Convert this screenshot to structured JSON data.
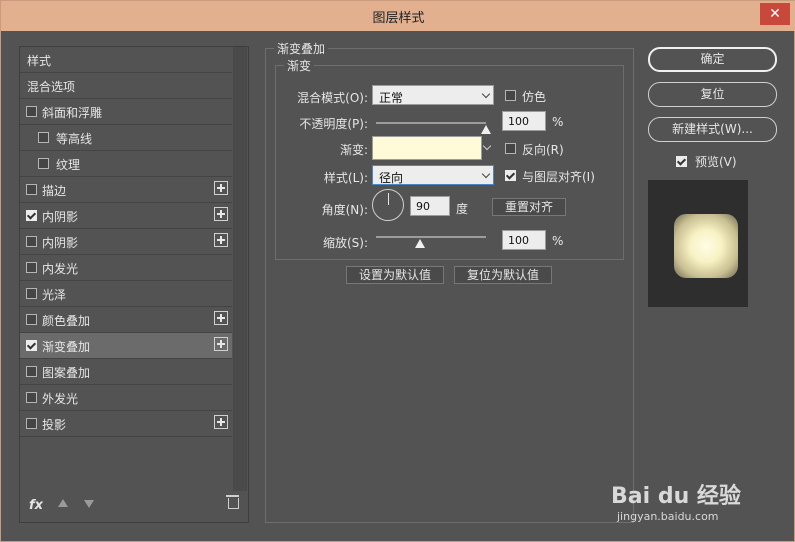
{
  "window": {
    "title": "图层样式",
    "close_glyph": "✕"
  },
  "sidebar": {
    "items": [
      {
        "label": "样式",
        "checkbox": null,
        "plus": false,
        "selected": false
      },
      {
        "label": "混合选项",
        "checkbox": null,
        "plus": false,
        "selected": false
      },
      {
        "label": "斜面和浮雕",
        "checkbox": false,
        "plus": false,
        "selected": false
      },
      {
        "label": "等高线",
        "checkbox": false,
        "plus": false,
        "selected": false,
        "sub": true
      },
      {
        "label": "纹理",
        "checkbox": false,
        "plus": false,
        "selected": false,
        "sub": true
      },
      {
        "label": "描边",
        "checkbox": false,
        "plus": true,
        "selected": false
      },
      {
        "label": "内阴影",
        "checkbox": true,
        "plus": true,
        "selected": false
      },
      {
        "label": "内阴影",
        "checkbox": false,
        "plus": true,
        "selected": false
      },
      {
        "label": "内发光",
        "checkbox": false,
        "plus": false,
        "selected": false
      },
      {
        "label": "光泽",
        "checkbox": false,
        "plus": false,
        "selected": false
      },
      {
        "label": "颜色叠加",
        "checkbox": false,
        "plus": true,
        "selected": false
      },
      {
        "label": "渐变叠加",
        "checkbox": true,
        "plus": true,
        "selected": true
      },
      {
        "label": "图案叠加",
        "checkbox": false,
        "plus": false,
        "selected": false
      },
      {
        "label": "外发光",
        "checkbox": false,
        "plus": false,
        "selected": false
      },
      {
        "label": "投影",
        "checkbox": false,
        "plus": true,
        "selected": false
      }
    ],
    "fx_label": "fx"
  },
  "panel": {
    "group_title": "渐变叠加",
    "subgroup_title": "渐变",
    "blend_mode_label": "混合模式(O):",
    "blend_mode_value": "正常",
    "dither_label": "仿色",
    "dither_checked": false,
    "opacity_label": "不透明度(P):",
    "opacity_value": "100",
    "opacity_unit": "%",
    "opacity_fraction": 1.0,
    "gradient_label": "渐变:",
    "gradient_color": "#fffbd9",
    "reverse_label": "反向(R)",
    "reverse_checked": false,
    "style_label": "样式(L):",
    "style_value": "径向",
    "align_label": "与图层对齐(I)",
    "align_checked": true,
    "angle_label": "角度(N):",
    "angle_value": "90",
    "angle_unit": "度",
    "reset_align_label": "重置对齐",
    "scale_label": "缩放(S):",
    "scale_value": "100",
    "scale_unit": "%",
    "scale_fraction": 0.4,
    "set_default_label": "设置为默认值",
    "reset_default_label": "复位为默认值"
  },
  "right": {
    "ok_label": "确定",
    "reset_label": "复位",
    "new_style_label": "新建样式(W)...",
    "preview_label": "预览(V)",
    "preview_checked": true
  },
  "watermark": {
    "brand": "Bai du 经验",
    "url": "jingyan.baidu.com"
  }
}
